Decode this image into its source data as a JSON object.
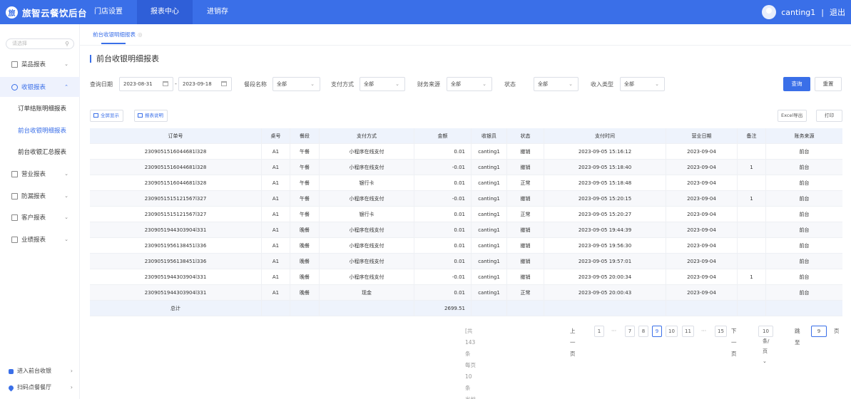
{
  "header": {
    "logo_text": "旅智云餐饮后台",
    "nav": [
      "门店设置",
      "报表中心",
      "进销存"
    ],
    "active_nav": 1,
    "user": "canting1",
    "separator": "|",
    "logout": "退出"
  },
  "sidebar": {
    "search_placeholder": "请选择",
    "groups": [
      {
        "label": "菜品报表",
        "open": false
      },
      {
        "label": "收银报表",
        "open": true
      },
      {
        "label": "营业报表",
        "open": false
      },
      {
        "label": "防漏报表",
        "open": false
      },
      {
        "label": "客户报表",
        "open": false
      },
      {
        "label": "业绩报表",
        "open": false
      }
    ],
    "sub_items": [
      "订单结账明细报表",
      "前台收银明细报表",
      "前台收银汇总报表"
    ],
    "active_sub": 1,
    "bottom_links": [
      "进入前台收银",
      "扫码点餐餐厅"
    ]
  },
  "tabbar": {
    "tab_label": "前台收银明细报表"
  },
  "page": {
    "title": "前台收银明细报表"
  },
  "filters": {
    "date_label": "查询日期",
    "date_start": "2023-08-31",
    "date_sep": "-",
    "date_end": "2023-09-18",
    "period_label": "餐段名称",
    "period_value": "全部",
    "pay_label": "支付方式",
    "pay_value": "全部",
    "source_label": "财务来源",
    "source_value": "全部",
    "status_label": "状态",
    "status_value": "全部",
    "income_label": "收入类型",
    "income_value": "全部",
    "query_button": "查询",
    "reset_button": "重置"
  },
  "toolbar": {
    "fullscreen": "全屏显示",
    "explain": "报表说明",
    "excel": "Excel导出",
    "print": "打印"
  },
  "table": {
    "columns": [
      "订单号",
      "桌号",
      "餐段",
      "支付方式",
      "金额",
      "收银员",
      "状态",
      "支付时间",
      "营业日期",
      "备注",
      "账务来源"
    ],
    "rows": [
      [
        "2309051516044681l328",
        "A1",
        "午餐",
        "小程序在线支付",
        "0.01",
        "canting1",
        "撤销",
        "2023-09-05 15:16:12",
        "2023-09-04",
        "",
        "前台"
      ],
      [
        "2309051516044681l328",
        "A1",
        "午餐",
        "小程序在线支付",
        "-0.01",
        "canting1",
        "撤销",
        "2023-09-05 15:18:40",
        "2023-09-04",
        "1",
        "前台"
      ],
      [
        "2309051516044681l328",
        "A1",
        "午餐",
        "银行卡",
        "0.01",
        "canting1",
        "正常",
        "2023-09-05 15:18:48",
        "2023-09-04",
        "",
        "前台"
      ],
      [
        "2309051515121567l327",
        "A1",
        "午餐",
        "小程序在线支付",
        "-0.01",
        "canting1",
        "撤销",
        "2023-09-05 15:20:15",
        "2023-09-04",
        "1",
        "前台"
      ],
      [
        "2309051515121567l327",
        "A1",
        "午餐",
        "银行卡",
        "0.01",
        "canting1",
        "正常",
        "2023-09-05 15:20:27",
        "2023-09-04",
        "",
        "前台"
      ],
      [
        "2309051944303904l331",
        "A1",
        "晚餐",
        "小程序在线支付",
        "0.01",
        "canting1",
        "撤销",
        "2023-09-05 19:44:39",
        "2023-09-04",
        "",
        "前台"
      ],
      [
        "2309051956138451l336",
        "A1",
        "晚餐",
        "小程序在线支付",
        "0.01",
        "canting1",
        "撤销",
        "2023-09-05 19:56:30",
        "2023-09-04",
        "",
        "前台"
      ],
      [
        "2309051956138451l336",
        "A1",
        "晚餐",
        "小程序在线支付",
        "0.01",
        "canting1",
        "撤销",
        "2023-09-05 19:57:01",
        "2023-09-04",
        "",
        "前台"
      ],
      [
        "2309051944303904l331",
        "A1",
        "晚餐",
        "小程序在线支付",
        "-0.01",
        "canting1",
        "撤销",
        "2023-09-05 20:00:34",
        "2023-09-04",
        "1",
        "前台"
      ],
      [
        "2309051944303904l331",
        "A1",
        "晚餐",
        "现金",
        "0.01",
        "canting1",
        "正常",
        "2023-09-05 20:00:43",
        "2023-09-04",
        "",
        "前台"
      ]
    ],
    "total_label": "总计",
    "total_amount": "2699.51"
  },
  "pager": {
    "info": "[共143条 每页10条 当前第9/15页]",
    "prev": "上一页",
    "next": "下一页",
    "pages": [
      "1",
      "···",
      "7",
      "8",
      "9",
      "10",
      "11",
      "···",
      "15"
    ],
    "current": "9",
    "page_size": "10条/页",
    "jump_label": "跳至",
    "jump_value": "9",
    "page_unit": "页"
  },
  "colors": {
    "primary": "#3a6fe8",
    "header_row": "#eef3fc"
  }
}
